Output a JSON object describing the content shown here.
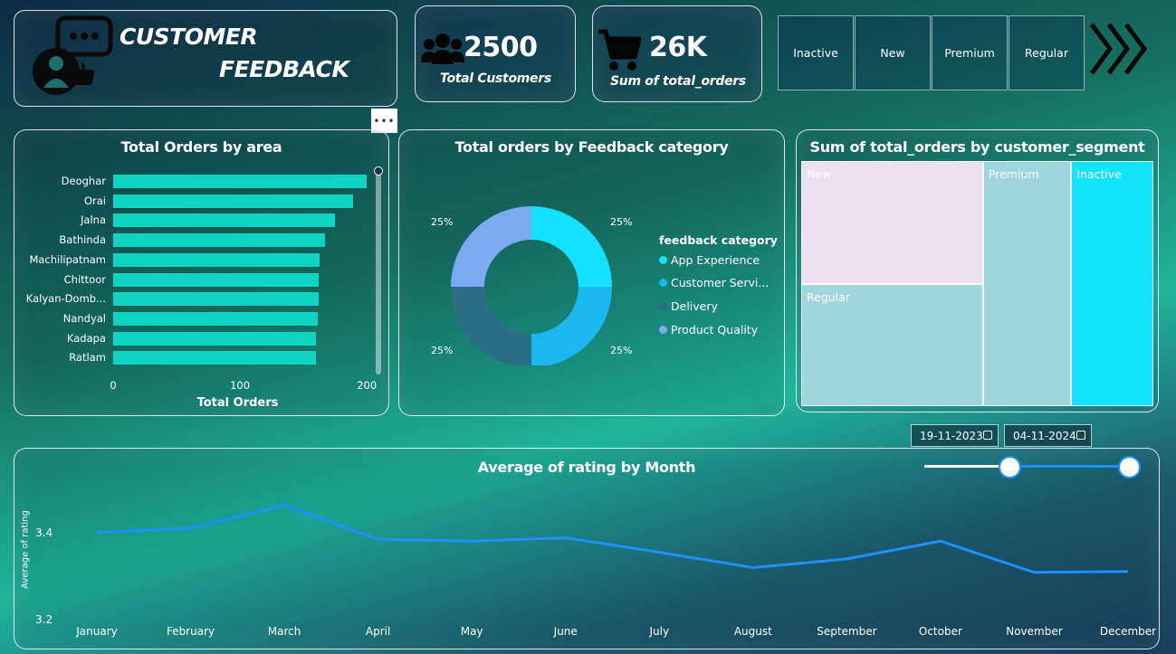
{
  "header": {
    "title_line1": "CUSTOMER",
    "title_line2": "FEEDBACK",
    "logo_icon": "customer-feedback-icon"
  },
  "kpis": [
    {
      "value": "2500",
      "label": "Total Customers",
      "icon": "users-icon"
    },
    {
      "value": "26K",
      "label": "Sum of total_orders",
      "icon": "shopping-cart-icon"
    }
  ],
  "segment_slicer": {
    "options": [
      "Inactive",
      "New",
      "Premium",
      "Regular"
    ]
  },
  "visual_menu_label": "•••",
  "area_chart": {
    "title": "Total Orders by area",
    "xlabel": "Total Orders"
  },
  "donut_chart": {
    "title": "Total orders by Feedback category",
    "legend_title": "feedback category",
    "legend": [
      "App Experience",
      "Customer Servi...",
      "Delivery",
      "Product Quality"
    ],
    "labels": [
      "25%",
      "25%",
      "25%",
      "25%"
    ]
  },
  "treemap": {
    "title": "Sum of total_orders by customer_segment"
  },
  "date_range": {
    "start": "19-11-2023",
    "end": "04-11-2024"
  },
  "line_chart": {
    "title": "Average of rating by Month",
    "ylabel": "Average of rating",
    "yticks": [
      "3.4",
      "3.2"
    ]
  },
  "colors": {
    "bar": "#0fd4c4",
    "line": "#1e90ff",
    "donut": [
      "#14e1ff",
      "#1bb8f0",
      "#2c6e86",
      "#7ba9f2"
    ],
    "treemap": [
      "#ebdff0",
      "#9fd5de",
      "#9fd5de",
      "#12e4fb"
    ]
  },
  "chart_data": [
    {
      "type": "bar",
      "title": "Total Orders by area",
      "xlabel": "Total Orders",
      "categories": [
        "Deoghar",
        "Orai",
        "Jalna",
        "Bathinda",
        "Machilipatnam",
        "Chittoor",
        "Kalyan-Domb...",
        "Nandyal",
        "Kadapa",
        "Ratlam"
      ],
      "values": [
        200,
        189,
        175,
        167,
        163,
        162,
        162,
        161,
        160,
        160
      ],
      "xlim": [
        0,
        207
      ],
      "xticks": [
        0,
        100,
        200
      ]
    },
    {
      "type": "pie",
      "title": "Total orders by Feedback category",
      "categories": [
        "App Experience",
        "Customer Servi...",
        "Delivery",
        "Product Quality"
      ],
      "values": [
        25,
        25,
        25,
        25
      ]
    },
    {
      "type": "heatmap",
      "title": "Sum of total_orders by customer_segment",
      "categories": [
        "New",
        "Regular",
        "Premium",
        "Inactive"
      ],
      "values": [
        0.2581,
        0.2581,
        0.2508,
        0.233
      ]
    },
    {
      "type": "line",
      "title": "Average of rating by Month",
      "ylabel": "Average of rating",
      "categories": [
        "January",
        "February",
        "March",
        "April",
        "May",
        "June",
        "July",
        "August",
        "September",
        "October",
        "November",
        "December"
      ],
      "values": [
        3.383,
        3.392,
        3.44,
        3.369,
        3.365,
        3.372,
        3.342,
        3.31,
        3.328,
        3.365,
        3.3,
        3.302
      ],
      "ylim": [
        3.2,
        3.45
      ],
      "yticks": [
        3.2,
        3.4
      ]
    }
  ]
}
